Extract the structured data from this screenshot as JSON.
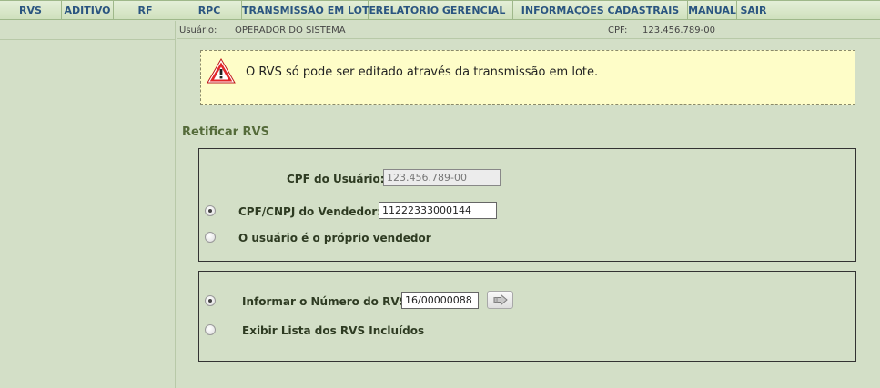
{
  "nav": {
    "items": [
      {
        "label": "RVS"
      },
      {
        "label": "ADITIVO"
      },
      {
        "label": "RF"
      },
      {
        "label": "RPC"
      },
      {
        "label": "TRANSMISSÃO EM LOTE"
      },
      {
        "label": "RELATORIO GERENCIAL"
      },
      {
        "label": "INFORMAÇÕES CADASTRAIS"
      },
      {
        "label": "MANUAL"
      },
      {
        "label": "SAIR"
      }
    ]
  },
  "userbar": {
    "user_label": "Usuário:",
    "user_value": "OPERADOR DO SISTEMA",
    "cpf_label": "CPF:",
    "cpf_value": "123.456.789-00"
  },
  "alert": {
    "icon": "warning-triangle-icon",
    "message": "O RVS só pode ser editado através da transmissão em lote."
  },
  "section": {
    "title": "Retificar RVS"
  },
  "form": {
    "cpf_usuario_label": "CPF do Usuário:",
    "cpf_usuario_value": "123.456.789-00",
    "vendedor_label": "CPF/CNPJ do Vendedor:",
    "vendedor_value": "11222333000144",
    "proprio_label": "O usuário é o próprio vendedor",
    "numero_label": "Informar o Número do RVS",
    "numero_value": "16/00000088",
    "lista_label": "Exibir Lista dos RVS Incluídos",
    "go_icon": "arrow-right-icon"
  },
  "colors": {
    "background": "#d3dfc7",
    "nav_text": "#2a5580",
    "alert_bg": "#fefdc8",
    "section_title": "#556b3a"
  }
}
